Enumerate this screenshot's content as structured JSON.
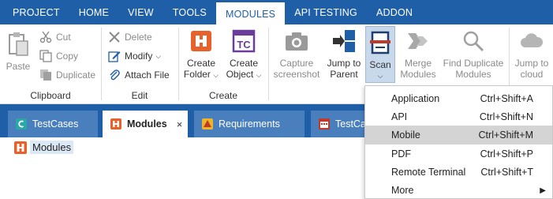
{
  "menu": {
    "tabs": [
      "PROJECT",
      "HOME",
      "VIEW",
      "TOOLS",
      "MODULES",
      "API TESTING",
      "ADDON"
    ],
    "active": "MODULES"
  },
  "ribbon": {
    "clipboard": {
      "label": "Clipboard",
      "paste": "Paste",
      "cut": "Cut",
      "copy": "Copy",
      "duplicate": "Duplicate"
    },
    "edit": {
      "label": "Edit",
      "delete": "Delete",
      "modify": "Modify",
      "attach": "Attach File"
    },
    "create": {
      "label": "Create",
      "folder_line1": "Create",
      "folder_line2": "Folder",
      "object_line1": "Create",
      "object_line2": "Object",
      "chevron": "⌄"
    },
    "tools": {
      "capture_line1": "Capture",
      "capture_line2": "screenshot",
      "jump_parent_line1": "Jump to",
      "jump_parent_line2": "Parent",
      "scan": "Scan",
      "merge_line1": "Merge",
      "merge_line2": "Modules",
      "find_line1": "Find Duplicate",
      "find_line2": "Modules",
      "jump_cloud_line1": "Jump to",
      "jump_cloud_line2": "cloud"
    }
  },
  "doc_tabs": {
    "testcases": "TestCases",
    "modules": "Modules",
    "requirements": "Requirements",
    "testcases2": "TestCas",
    "close": "×"
  },
  "tree": {
    "root": "Modules"
  },
  "scan_menu": {
    "items": [
      {
        "name": "Application",
        "shortcut": "Ctrl+Shift+A"
      },
      {
        "name": "API",
        "shortcut": "Ctrl+Shift+N"
      },
      {
        "name": "Mobile",
        "shortcut": "Ctrl+Shift+M"
      },
      {
        "name": "PDF",
        "shortcut": "Ctrl+Shift+P"
      },
      {
        "name": "Remote Terminal",
        "shortcut": "Ctrl+Shift+T"
      },
      {
        "name": "More",
        "shortcut": ""
      }
    ],
    "highlighted": "Mobile",
    "submenu_arrow": "▶"
  },
  "colors": {
    "accent": "#1f5fa8",
    "tab_inactive": "#4a7fbd",
    "module_icon": "#e8612c",
    "object_icon": "#6a3d9a",
    "highlight": "#d4d4d4"
  }
}
